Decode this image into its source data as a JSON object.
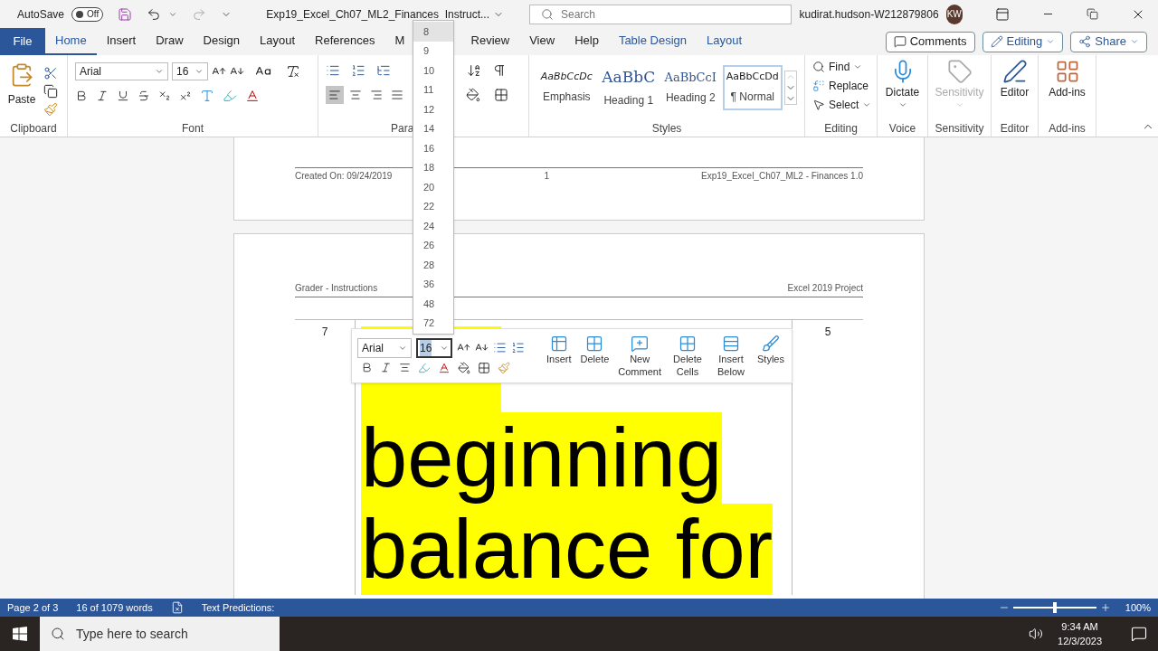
{
  "title_bar": {
    "autosave_label": "AutoSave",
    "autosave_on": false,
    "autosave_state": "Off",
    "document_title": "Exp19_Excel_Ch07_ML2_Finances_Instruct...",
    "search_placeholder": "Search",
    "user_name": "kudirat.hudson-W212879806",
    "avatar_initials": "KW"
  },
  "tabs": [
    {
      "label": "File",
      "kind": "file",
      "selected": false
    },
    {
      "label": "Home",
      "kind": "normal",
      "selected": true
    },
    {
      "label": "Insert",
      "kind": "normal",
      "selected": false
    },
    {
      "label": "Draw",
      "kind": "normal",
      "selected": false
    },
    {
      "label": "Design",
      "kind": "normal",
      "selected": false
    },
    {
      "label": "Layout",
      "kind": "normal",
      "selected": false
    },
    {
      "label": "References",
      "kind": "normal",
      "selected": false
    },
    {
      "label": "M",
      "kind": "normal",
      "selected": false
    },
    {
      "label": "Review",
      "kind": "normal",
      "selected": false
    },
    {
      "label": "View",
      "kind": "normal",
      "selected": false
    },
    {
      "label": "Help",
      "kind": "normal",
      "selected": false
    },
    {
      "label": "Table Design",
      "kind": "contextual",
      "selected": false
    },
    {
      "label": "Layout",
      "kind": "contextual",
      "selected": false
    }
  ],
  "actions": {
    "comments": "Comments",
    "editing": "Editing",
    "share": "Share"
  },
  "clipboard": {
    "paste": "Paste",
    "label": "Clipboard"
  },
  "font": {
    "name": "Arial",
    "size": "16",
    "label": "Font"
  },
  "paragraph": {
    "label": "Para",
    "align_buttons": [
      {
        "kind": "left",
        "selected": true
      },
      {
        "kind": "center",
        "selected": false
      },
      {
        "kind": "right",
        "selected": false
      },
      {
        "kind": "justify",
        "selected": false
      }
    ]
  },
  "styles": {
    "label": "Styles",
    "items": [
      {
        "preview": "AaBbCcDc",
        "label": "Emphasis",
        "kind": "emphasis",
        "selected": false
      },
      {
        "preview": "AaBbC",
        "label": "Heading 1",
        "kind": "heading1",
        "selected": false
      },
      {
        "preview": "AaBbCcI",
        "label": "Heading 2",
        "kind": "heading2",
        "selected": false
      },
      {
        "preview": "AaBbCcDd",
        "label": "¶ Normal",
        "kind": "normal",
        "selected": true
      }
    ]
  },
  "editing": {
    "find": "Find",
    "replace": "Replace",
    "select": "Select",
    "label": "Editing"
  },
  "voice": {
    "dictate": "Dictate",
    "label": "Voice"
  },
  "sensitivity": {
    "button": "Sensitivity",
    "label": "Sensitivity",
    "disabled": true
  },
  "editor": {
    "button": "Editor",
    "label": "Editor"
  },
  "addins": {
    "button": "Add-ins",
    "label": "Add-ins"
  },
  "size_dropdown": [
    {
      "label": "8",
      "selected": true
    },
    {
      "label": "9",
      "selected": false
    },
    {
      "label": "10",
      "selected": false
    },
    {
      "label": "11",
      "selected": false
    },
    {
      "label": "12",
      "selected": false
    },
    {
      "label": "14",
      "selected": false
    },
    {
      "label": "16",
      "selected": false
    },
    {
      "label": "18",
      "selected": false
    },
    {
      "label": "20",
      "selected": false
    },
    {
      "label": "22",
      "selected": false
    },
    {
      "label": "24",
      "selected": false
    },
    {
      "label": "26",
      "selected": false
    },
    {
      "label": "28",
      "selected": false
    },
    {
      "label": "36",
      "selected": false
    },
    {
      "label": "48",
      "selected": false
    },
    {
      "label": "72",
      "selected": false
    }
  ],
  "document": {
    "page1_footer": {
      "left": "Created On: 09/24/2019",
      "center": "1",
      "right": "Exp19_Excel_Ch07_ML2 - Finances 1.0"
    },
    "page2_header": {
      "left": "Grader - Instructions",
      "right": "Excel 2019 Project"
    },
    "table_row": {
      "step": "7",
      "lines": [
        "beginning",
        "balance for"
      ],
      "points": "5"
    }
  },
  "mini_toolbar": {
    "font": "Arial",
    "size": "16",
    "buttons": [
      {
        "label": "Insert",
        "kind": "insert"
      },
      {
        "label": "Delete",
        "kind": "delete"
      },
      {
        "label": "New Comment",
        "kind": "comment"
      },
      {
        "label": "Delete Cells",
        "kind": "delete_cells"
      },
      {
        "label": "Insert Below",
        "kind": "insert_below"
      },
      {
        "label": "Styles",
        "kind": "styles"
      }
    ]
  },
  "status_bar": {
    "page": "Page 2 of 3",
    "words": "16 of 1079 words",
    "text_predictions": "Text Predictions:",
    "zoom": "100%",
    "zoom_slider": {
      "level": 0.5
    }
  },
  "taskbar": {
    "search_placeholder": "Type here to search",
    "time": "9:34 AM",
    "date": "12/3/2023"
  }
}
